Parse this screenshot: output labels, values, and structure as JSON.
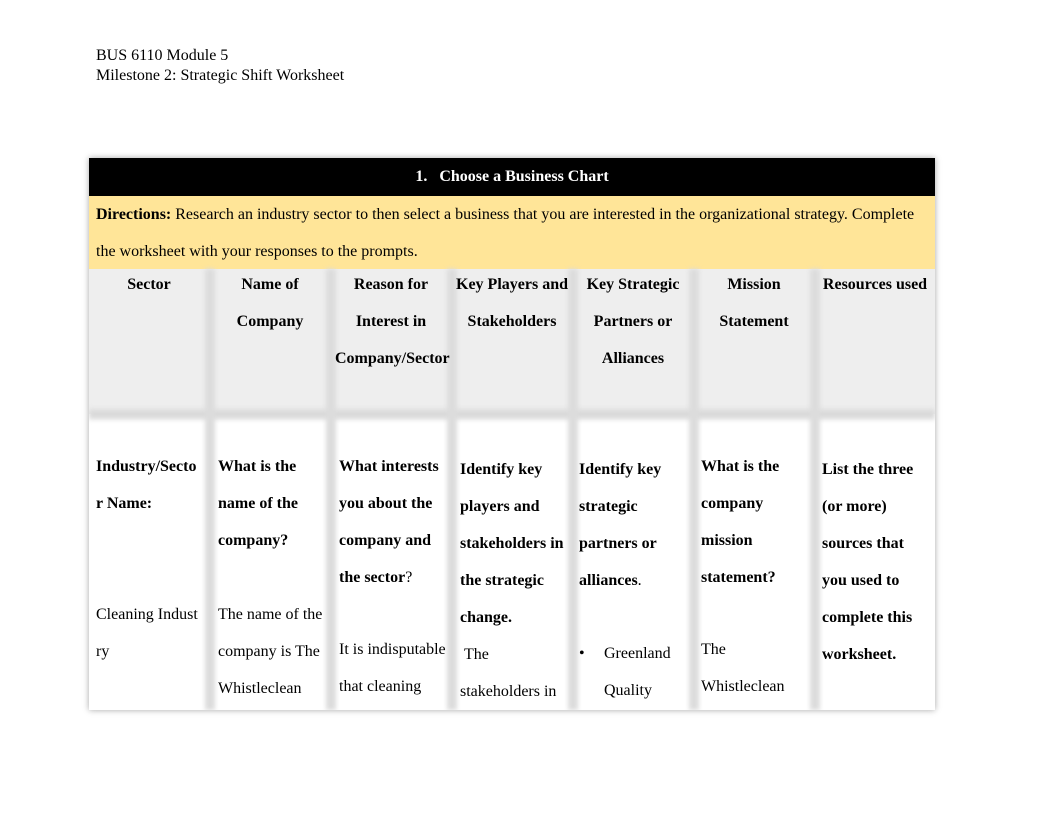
{
  "document": {
    "header_line1": "BUS 6110 Module 5",
    "header_line2": "Milestone 2: Strategic Shift Worksheet"
  },
  "section": {
    "number": "1.",
    "title": "Choose a Business Chart",
    "directions_label": "Directions:",
    "directions_text": " Research an industry sector to then select a business that you are interested in the organizational strategy. Complete the worksheet with your responses to the prompts."
  },
  "colors": {
    "title_bar": "#000000",
    "directions_bg": "#ffe598",
    "header_bg": "#eeeeee"
  },
  "columns": [
    {
      "header": "Sector",
      "prompt": "Industry/Sector Name:",
      "answer": "Cleaning Industry"
    },
    {
      "header": "Name of Company",
      "prompt": "What is the name of the company?",
      "answer": "The name of the company is The Whistleclean"
    },
    {
      "header": "Reason for Interest in Company/Sector",
      "prompt": "What interests you about the company and the sector",
      "prompt_suffix": "?",
      "answer": "It is indisputable that cleaning"
    },
    {
      "header": "Key Players and Stakeholders",
      "prompt": "Identify key players and stakeholders in the strategic change.",
      "answer": " The stakeholders in"
    },
    {
      "header": "Key Strategic Partners or Alliances",
      "prompt": "Identify key strategic partners or alliances",
      "prompt_suffix": ".",
      "bullet_icon": "•",
      "answer": "Greenland Quality"
    },
    {
      "header": "Mission Statement",
      "prompt": "What is the company mission statement?",
      "answer": "The Whistleclean"
    },
    {
      "header": "Resources used",
      "prompt": "List the three (or more) sources that you used to complete this worksheet."
    }
  ]
}
